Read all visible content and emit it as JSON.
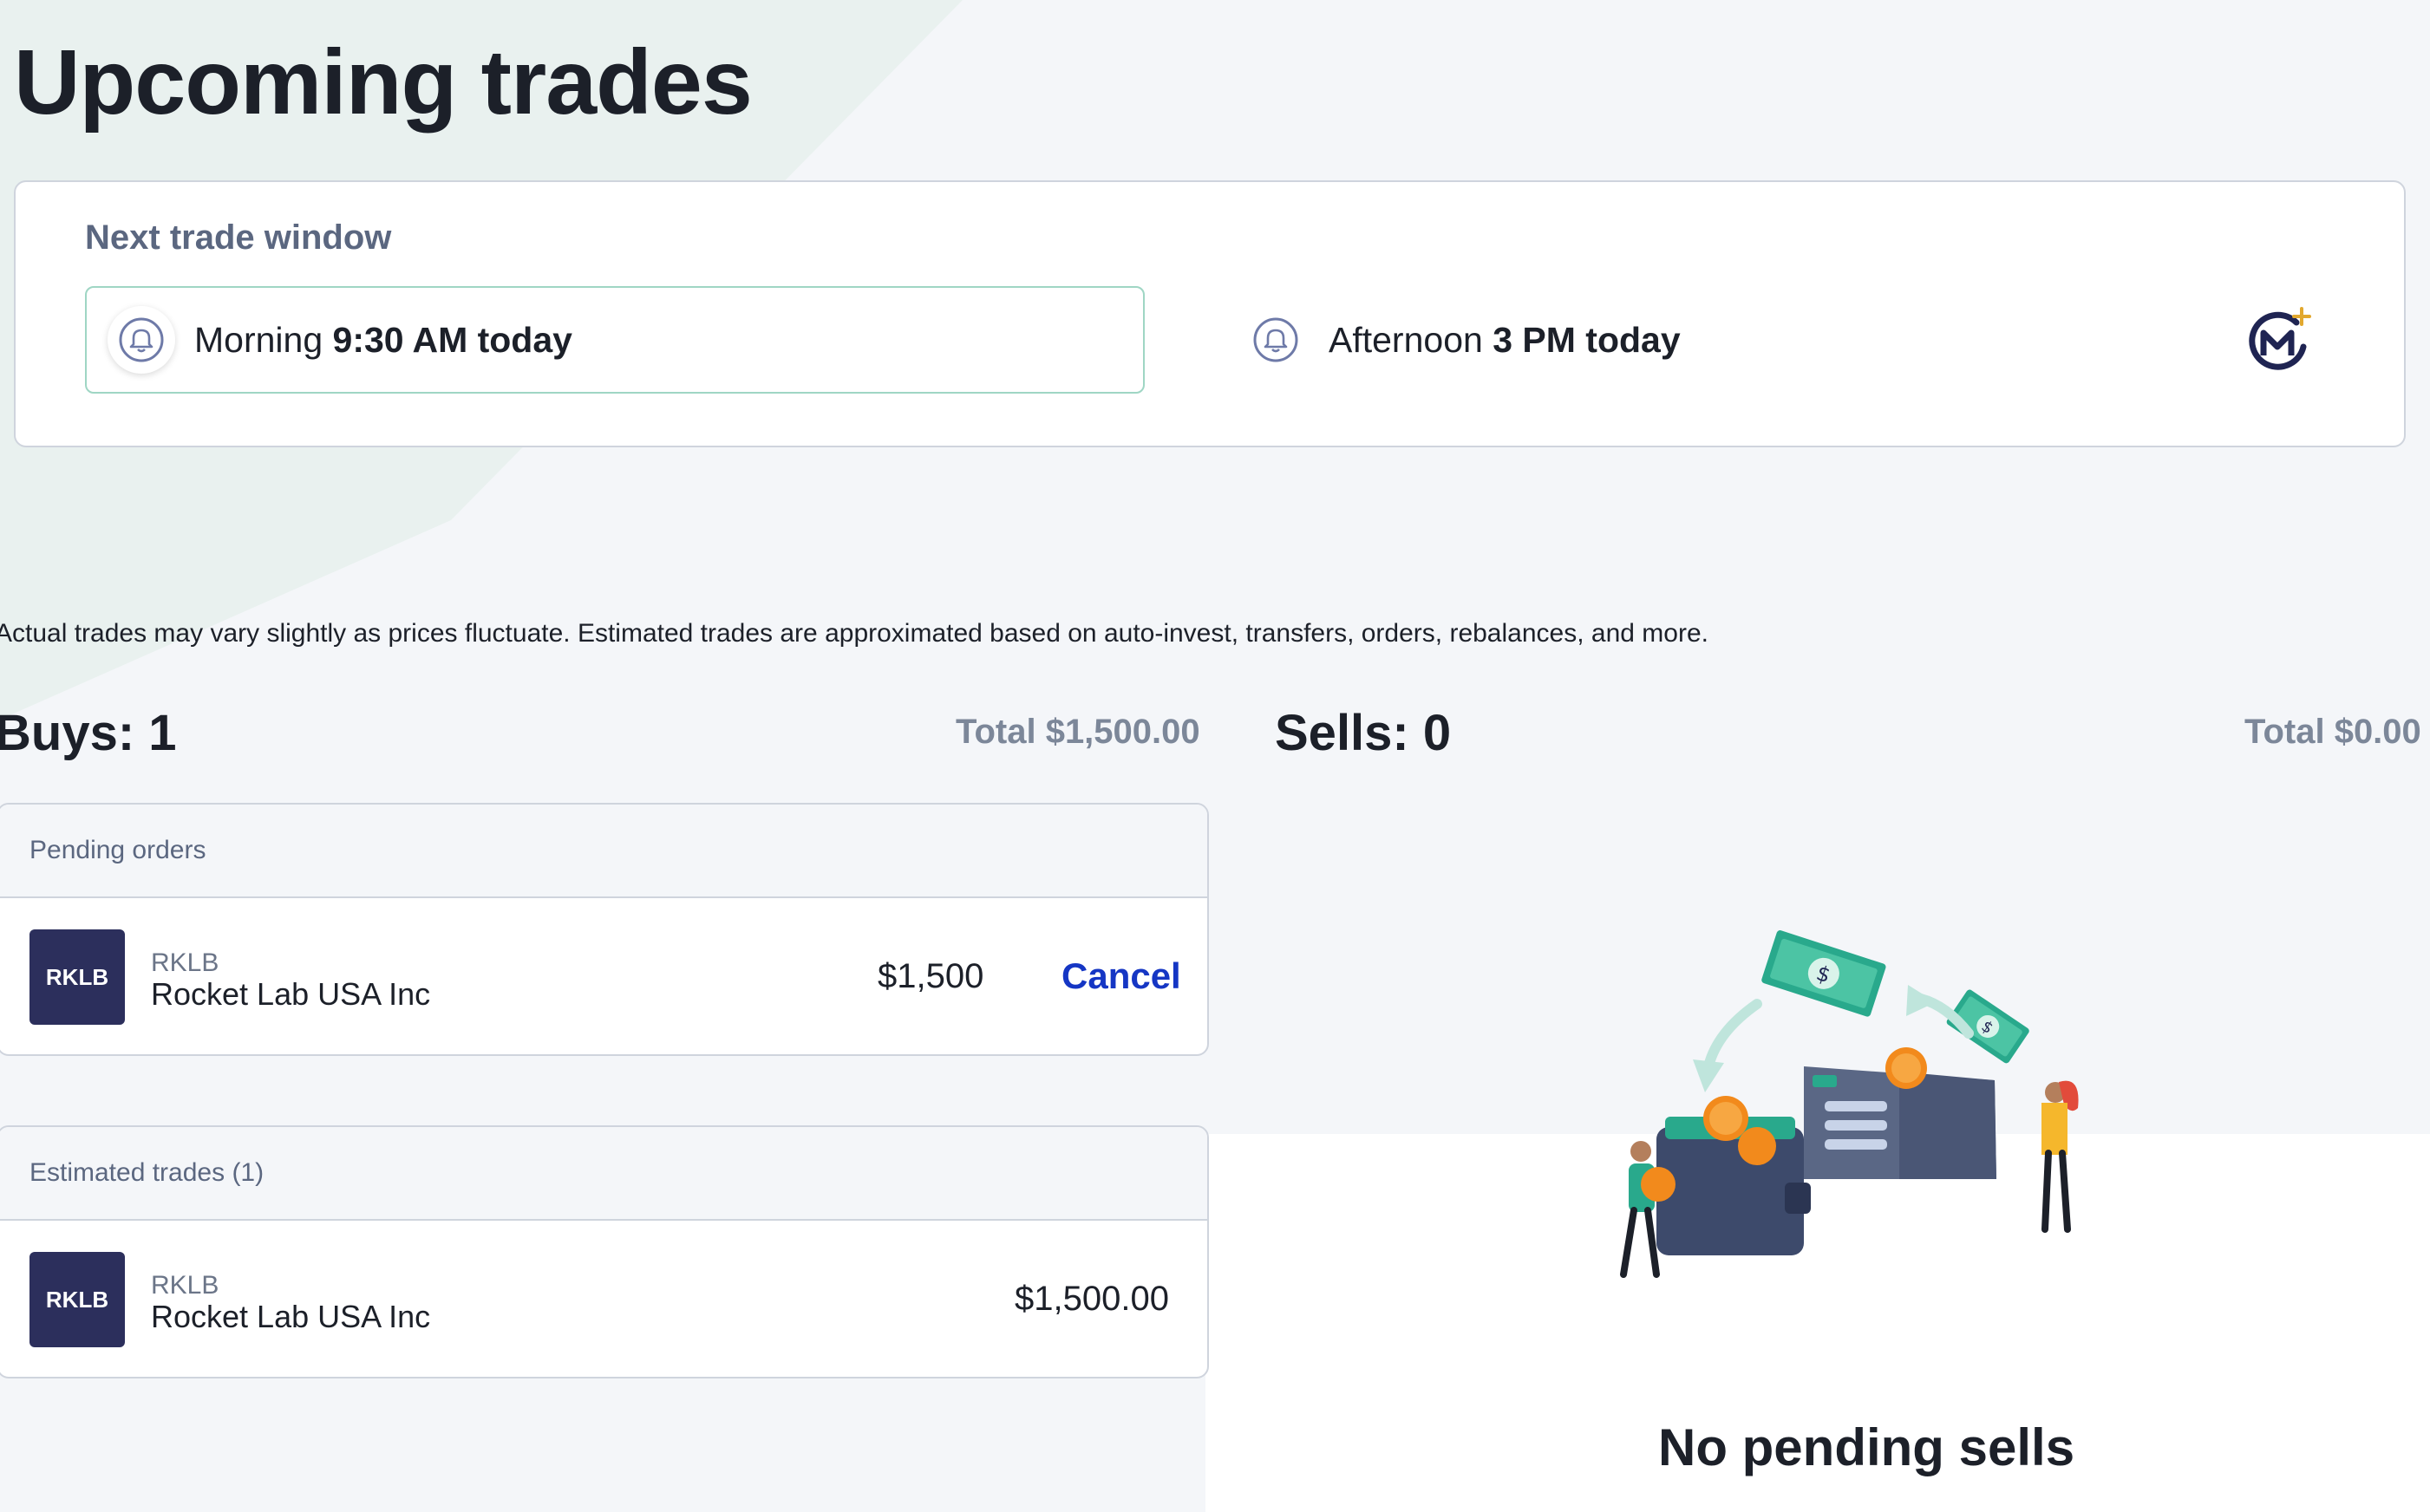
{
  "page": {
    "title": "Upcoming trades"
  },
  "trade_window": {
    "label": "Next trade window",
    "slots": [
      {
        "period": "Morning",
        "time": "9:30 AM today",
        "active": true
      },
      {
        "period": "Afternoon",
        "time": "3 PM today",
        "active": false
      }
    ]
  },
  "disclaimer": "Actual trades may vary slightly as prices fluctuate. Estimated trades are approximated based on auto-invest, transfers, orders, rebalances, and more.",
  "buys": {
    "heading": "Buys: 1",
    "total": "Total $1,500.00",
    "pending_orders": {
      "header": "Pending orders",
      "items": [
        {
          "badge": "RKLB",
          "symbol": "RKLB",
          "name": "Rocket Lab USA Inc",
          "amount": "$1,500",
          "action": "Cancel"
        }
      ]
    },
    "estimated_trades": {
      "header": "Estimated trades (1)",
      "items": [
        {
          "badge": "RKLB",
          "symbol": "RKLB",
          "name": "Rocket Lab USA Inc",
          "amount": "$1,500.00"
        }
      ]
    }
  },
  "sells": {
    "heading": "Sells: 0",
    "total": "Total $0.00",
    "empty_message": "No pending sells"
  },
  "colors": {
    "accent_teal": "#9fd6c4",
    "link_blue": "#1536c4",
    "badge_navy": "#2c2f5c",
    "brand_gold": "#e2a82e"
  },
  "icons": {
    "slot_icon": "bell-icon",
    "brand": "m1-logo-icon",
    "empty_state": "wallet-money-illustration"
  }
}
